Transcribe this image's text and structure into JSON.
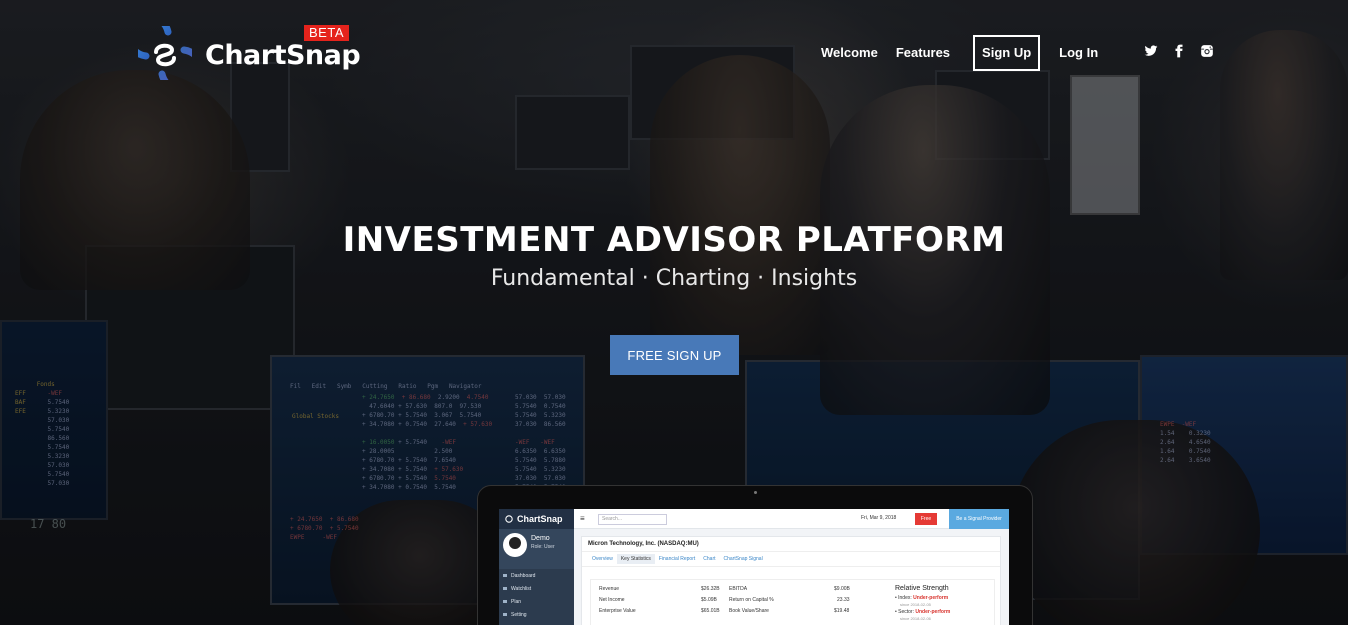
{
  "brand": {
    "name": "ChartSnap",
    "badge": "BETA"
  },
  "nav": {
    "welcome": "Welcome",
    "features": "Features",
    "signup": "Sign Up",
    "login": "Log In"
  },
  "social": [
    "twitter-icon",
    "facebook-icon",
    "instagram-icon"
  ],
  "hero": {
    "title": "INVESTMENT ADVISOR PLATFORM",
    "subtitle": "Fundamental · Charting · Insights",
    "cta": "FREE SIGN UP"
  },
  "colors": {
    "cta": "#4879b8",
    "beta": "#e5231c",
    "logo_blue": "#2a6fb5"
  },
  "mockup": {
    "brand": "ChartSnap",
    "user_name": "Demo",
    "user_role": "Role: User",
    "sidebar": [
      "Dashboard",
      "Watchlist",
      "Plan",
      "Setting"
    ],
    "search_placeholder": "Search...",
    "date": "Fri, Mar 9, 2018",
    "free_label": "Free",
    "signal_label": "Be a Signal Provider",
    "company": "Micron Technology, Inc. (NASDAQ:MU)",
    "tabs": [
      "Overview",
      "Key Statistics",
      "Financial Report",
      "Chart",
      "ChartSnap Signal"
    ],
    "stats_left": [
      {
        "label": "Revenue",
        "value": "$26.32B"
      },
      {
        "label": "Net Income",
        "value": "$5.09B"
      },
      {
        "label": "Enterprise Value",
        "value": "$65.01B"
      }
    ],
    "stats_right": [
      {
        "label": "EBITDA",
        "value": "$9.00B"
      },
      {
        "label": "Return on Capital %",
        "value": "23.33"
      },
      {
        "label": "Book Value/Share",
        "value": "$19.48"
      }
    ],
    "relative_strength": {
      "title": "Relative Strength",
      "index_label": "Index:",
      "index_value": "Under-perform",
      "index_since": "since 2018-02-05",
      "sector_label": "Sector:",
      "sector_value": "Under-perform",
      "sector_since": "since 2018-02-06"
    }
  }
}
